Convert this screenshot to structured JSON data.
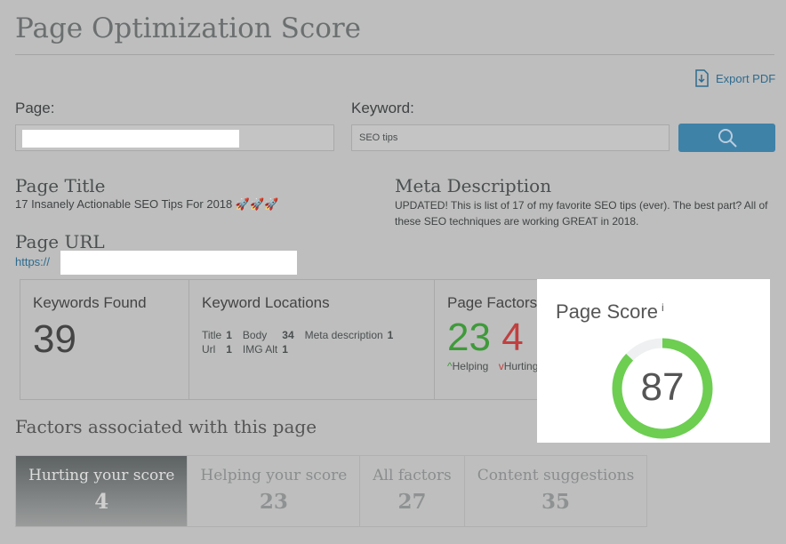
{
  "header": {
    "title": "Page Optimization Score",
    "export_label": "Export PDF"
  },
  "form": {
    "page_label": "Page:",
    "page_value": "",
    "keyword_label": "Keyword:",
    "keyword_value": "SEO tips"
  },
  "page_title": {
    "label": "Page Title",
    "value": "17 Insanely Actionable SEO Tips For 2018 🚀🚀🚀"
  },
  "page_url": {
    "label": "Page URL",
    "value": "https://"
  },
  "meta": {
    "label": "Meta Description",
    "value": "UPDATED! This is list of 17 of my favorite SEO tips (ever). The best part? All of these SEO techniques are working GREAT in 2018."
  },
  "keywords_found": {
    "label": "Keywords Found",
    "value": "39"
  },
  "locations": {
    "label": "Keyword Locations",
    "title_l": "Title",
    "title_v": "1",
    "body_l": "Body",
    "body_v": "34",
    "meta_l": "Meta description",
    "meta_v": "1",
    "url_l": "Url",
    "url_v": "1",
    "img_l": "IMG Alt",
    "img_v": "1"
  },
  "factors": {
    "label": "Page Factors",
    "helping": "23",
    "helping_label": "Helping",
    "hurting": "4",
    "hurting_label": "Hurting"
  },
  "score": {
    "label": "Page Score",
    "info": "i",
    "value": "87",
    "percent": 87,
    "color": "#6dce52"
  },
  "section": {
    "title": "Factors associated with this page"
  },
  "tabs": [
    {
      "label": "Hurting your score",
      "count": "4"
    },
    {
      "label": "Helping your score",
      "count": "23"
    },
    {
      "label": "All factors",
      "count": "27"
    },
    {
      "label": "Content suggestions",
      "count": "35"
    }
  ]
}
